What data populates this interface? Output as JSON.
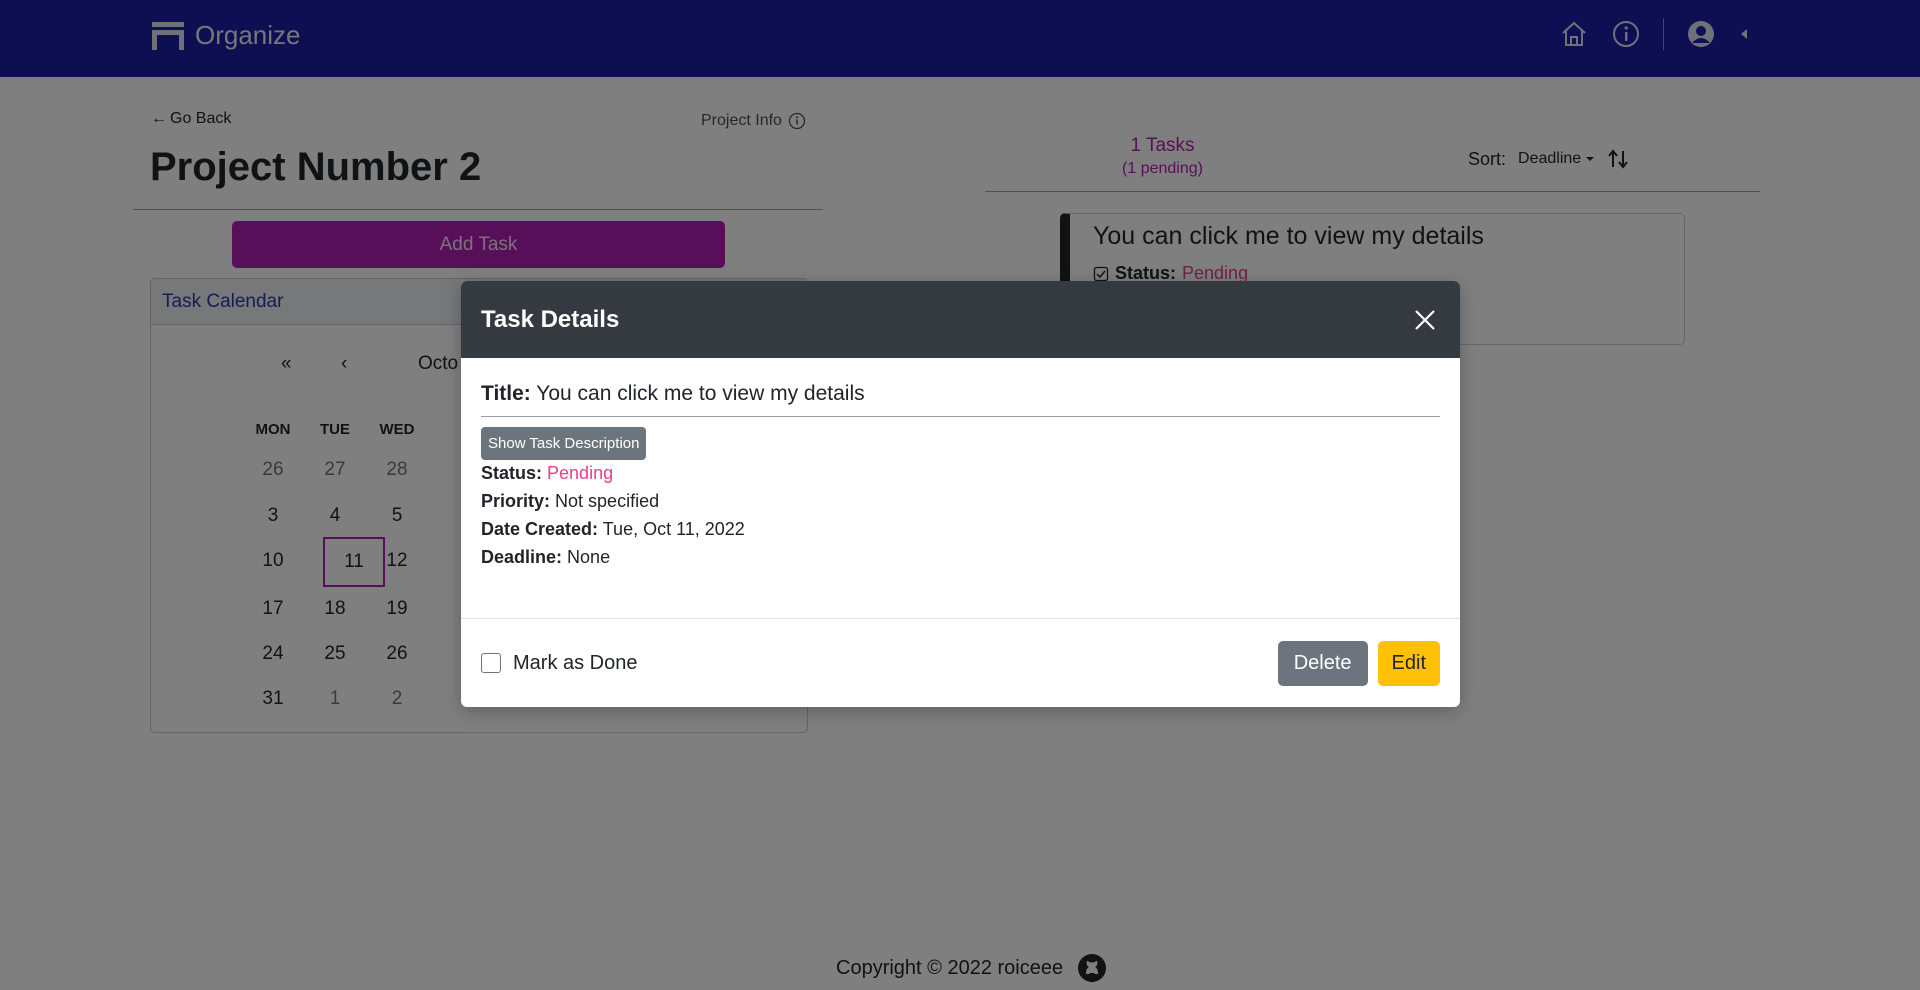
{
  "navbar": {
    "brand": "Organize",
    "icons": [
      "home-icon",
      "info-icon",
      "user-avatar-icon",
      "caret-left-icon"
    ]
  },
  "project": {
    "go_back": "Go Back",
    "info_label": "Project Info",
    "title": "Project Number 2",
    "add_task": "Add Task"
  },
  "calendar": {
    "header": "Task Calendar",
    "nav_first": "«",
    "nav_prev": "‹",
    "month_partial": "Octo",
    "weekdays": [
      "MON",
      "TUE",
      "WED"
    ],
    "weeks": [
      [
        "26",
        "27",
        "28"
      ],
      [
        "3",
        "4",
        "5"
      ],
      [
        "10",
        "11",
        "12"
      ],
      [
        "17",
        "18",
        "19"
      ],
      [
        "24",
        "25",
        "26"
      ],
      [
        "31",
        "1",
        "2"
      ]
    ],
    "today": "11"
  },
  "tasks_panel": {
    "count": "1 Tasks",
    "pending": "(1 pending)",
    "sort_label": "Sort:",
    "sort_value": "Deadline",
    "card": {
      "title": "You can click me to view my details",
      "status_label": "Status:",
      "status_value": "Pending"
    }
  },
  "modal": {
    "title": "Task Details",
    "task_title_label": "Title:",
    "task_title_value": "You can click me to view my details",
    "show_description": "Show Task Description",
    "status_label": "Status:",
    "status_value": "Pending",
    "priority_label": "Priority:",
    "priority_value": "Not specified",
    "created_label": "Date Created:",
    "created_value": "Tue, Oct 11, 2022",
    "deadline_label": "Deadline:",
    "deadline_value": "None",
    "mark_done": "Mark as Done",
    "delete": "Delete",
    "edit": "Edit"
  },
  "footer": {
    "copyright": "Copyright © 2022 roiceee"
  },
  "colors": {
    "navbar": "#1c1fa6",
    "accent": "#b01eb3",
    "pending": "#e83e8c",
    "edit": "#ffc107",
    "delete": "#6c757d"
  }
}
